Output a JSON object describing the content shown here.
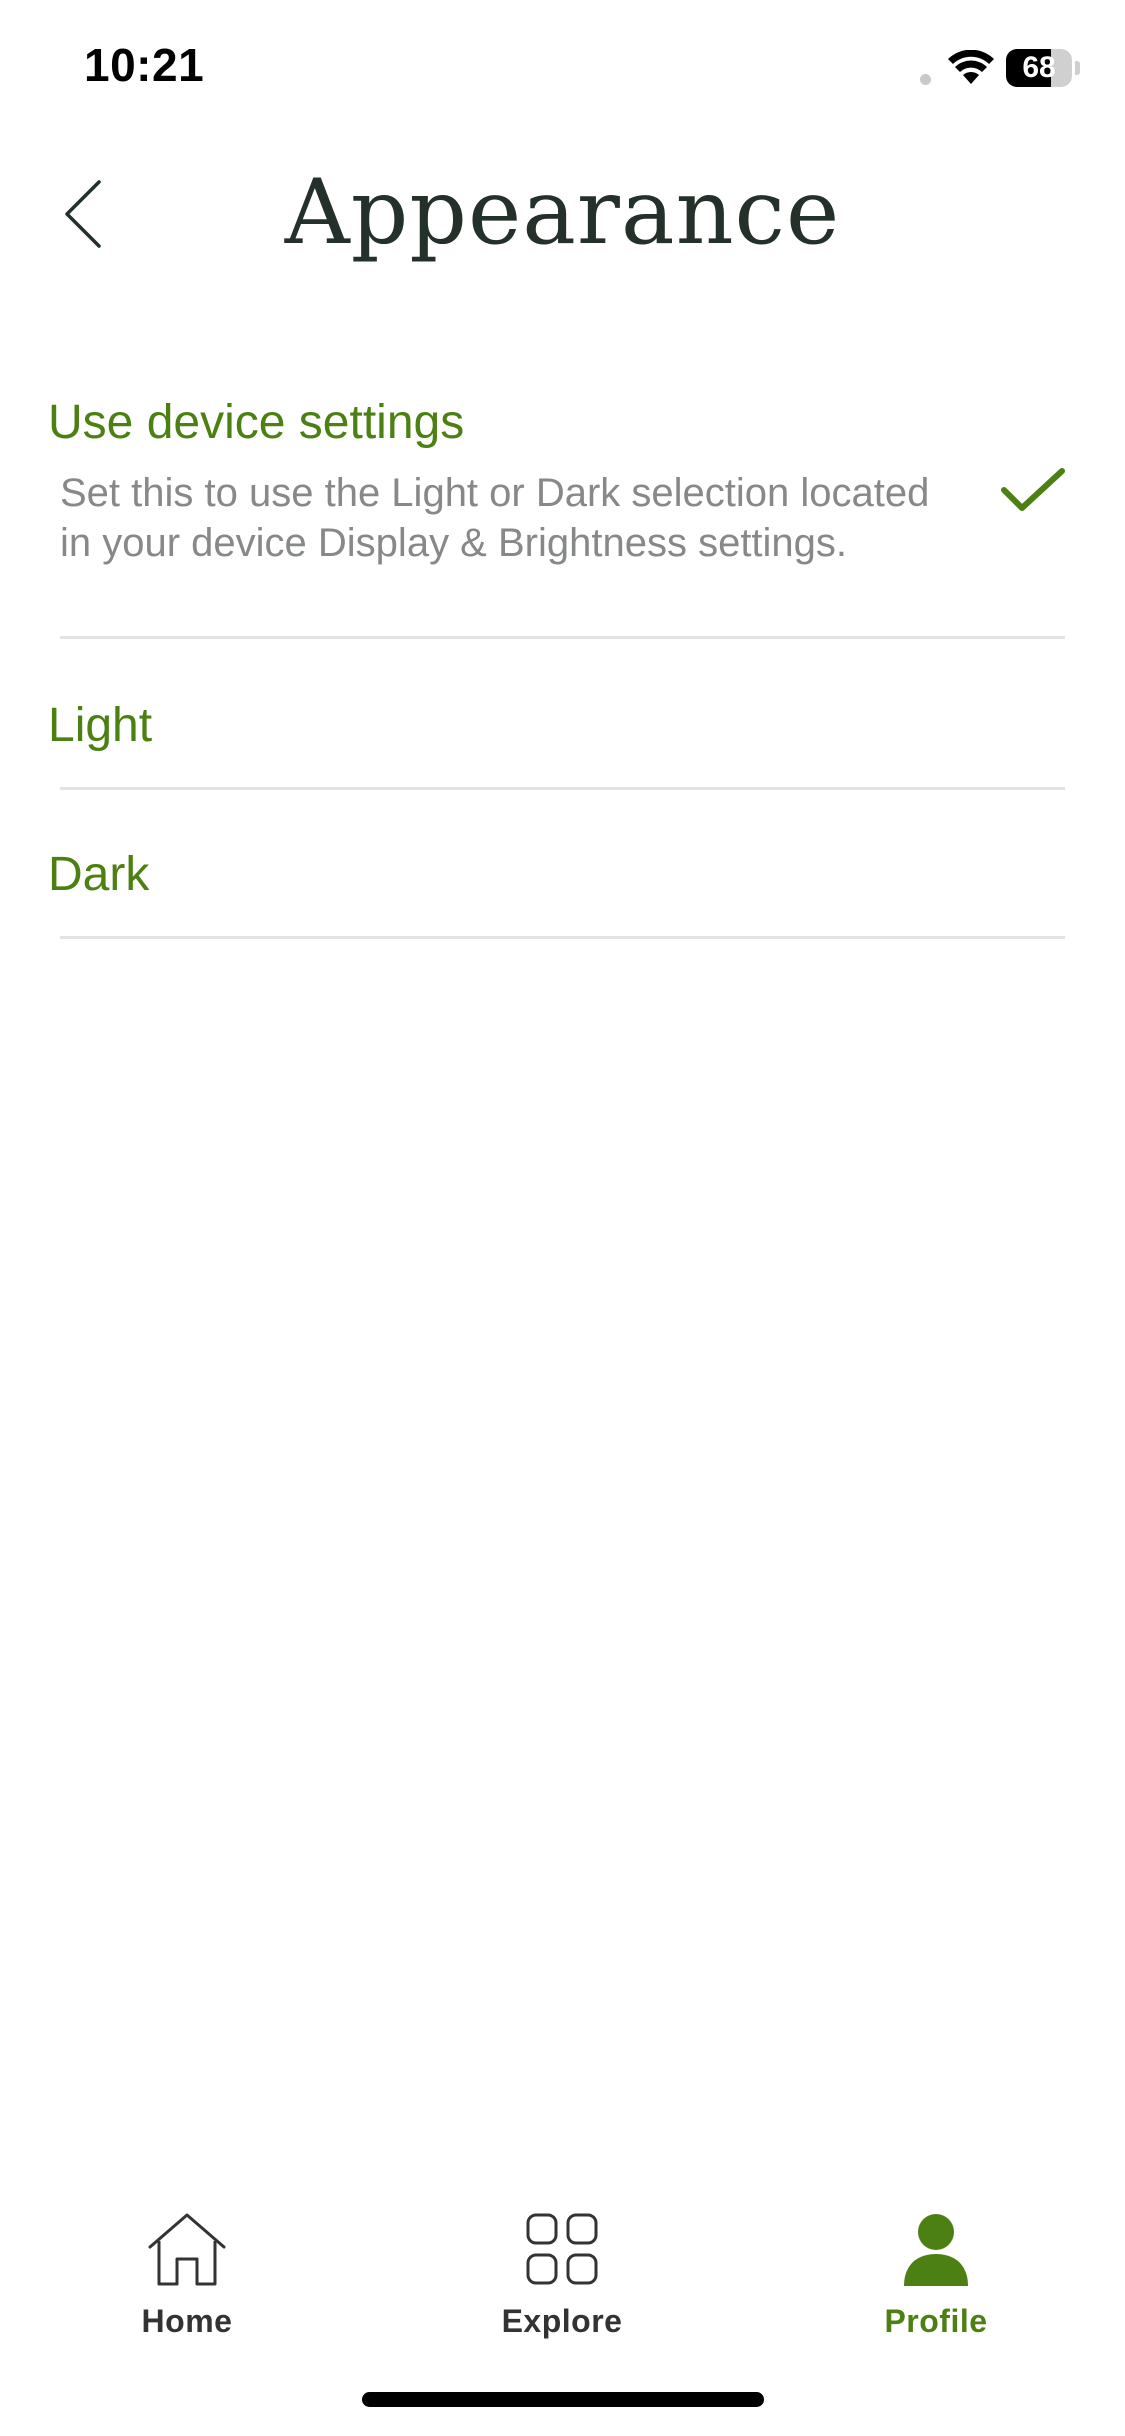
{
  "status_bar": {
    "time": "10:21",
    "battery_level": "68",
    "battery_fraction": 0.68
  },
  "header": {
    "title": "Appearance",
    "back_icon": "chevron-left-icon"
  },
  "options": [
    {
      "label": "Use device settings",
      "description": "Set this to use the Light or Dark selection located in your device Display & Brightness settings.",
      "selected": true
    },
    {
      "label": "Light",
      "selected": false
    },
    {
      "label": "Dark",
      "selected": false
    }
  ],
  "tab_bar": {
    "items": [
      {
        "label": "Home",
        "icon": "home-icon",
        "active": false
      },
      {
        "label": "Explore",
        "icon": "grid-icon",
        "active": false
      },
      {
        "label": "Profile",
        "icon": "person-icon",
        "active": true
      }
    ]
  },
  "colors": {
    "accent": "#4c8012",
    "title": "#24302a",
    "description": "#86888a",
    "divider": "#e2e4e2"
  }
}
